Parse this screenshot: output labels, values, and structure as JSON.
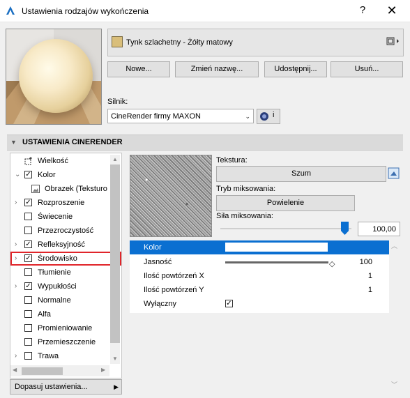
{
  "window": {
    "title": "Ustawienia rodzajów wykończenia",
    "help": "?",
    "close": "✕"
  },
  "material": {
    "name": "Tynk szlachetny - Żółty matowy",
    "swatch_color": "#d9be7a",
    "menu_icon": "⧉▸"
  },
  "buttons": {
    "new": "Nowe...",
    "rename": "Zmień nazwę...",
    "share": "Udostępnij...",
    "delete": "Usuń..."
  },
  "engine": {
    "label": "Silnik:",
    "value": "CineRender firmy MAXON",
    "info": "i"
  },
  "section": {
    "title": "USTAWIENIA CINERENDER"
  },
  "tree": [
    {
      "label": "Wielkość",
      "expander": "",
      "checked": null,
      "icon": "size-icon"
    },
    {
      "label": "Kolor",
      "expander": "⌄",
      "checked": true
    },
    {
      "label": "Obrazek (Teksturo",
      "expander": "",
      "checked": null,
      "icon": "image-icon"
    },
    {
      "label": "Rozproszenie",
      "expander": "›",
      "checked": true
    },
    {
      "label": "Świecenie",
      "expander": "",
      "checked": false
    },
    {
      "label": "Przezroczystość",
      "expander": "",
      "checked": false
    },
    {
      "label": "Refleksyjność",
      "expander": "›",
      "checked": true
    },
    {
      "label": "Środowisko",
      "expander": "›",
      "checked": true,
      "selected": true
    },
    {
      "label": "Tłumienie",
      "expander": "",
      "checked": false
    },
    {
      "label": "Wypukłości",
      "expander": "›",
      "checked": true
    },
    {
      "label": "Normalne",
      "expander": "",
      "checked": false
    },
    {
      "label": "Alfa",
      "expander": "",
      "checked": false
    },
    {
      "label": "Promieniowanie",
      "expander": "",
      "checked": false
    },
    {
      "label": "Przemieszczenie",
      "expander": "",
      "checked": false
    },
    {
      "label": "Trawa",
      "expander": "›",
      "checked": false
    }
  ],
  "texture_panel": {
    "texture_label": "Tekstura:",
    "texture_value": "Szum",
    "blend_label": "Tryb miksowania:",
    "blend_value": "Powielenie",
    "strength_label": "Siła miksowania:",
    "strength_value": "100,00",
    "strength_fraction": 1.0
  },
  "properties": [
    {
      "name": "Kolor",
      "value": "",
      "type": "color",
      "selected": true
    },
    {
      "name": "Jasność",
      "value": "100",
      "type": "slider"
    },
    {
      "name": "Ilość powtórzeń X",
      "value": "1",
      "type": "number"
    },
    {
      "name": "Ilość powtórzeń Y",
      "value": "1",
      "type": "number"
    },
    {
      "name": "Wyłączny",
      "value": "",
      "type": "checkbox",
      "checked": true
    }
  ],
  "footer": {
    "adjust": "Dopasuj ustawienia..."
  }
}
